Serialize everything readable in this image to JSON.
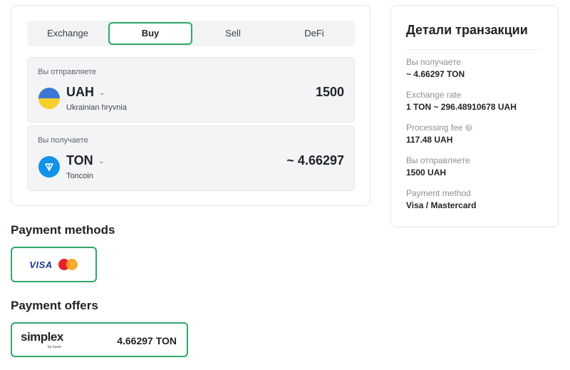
{
  "tabs": [
    {
      "label": "Exchange",
      "active": false
    },
    {
      "label": "Buy",
      "active": true
    },
    {
      "label": "Sell",
      "active": false
    },
    {
      "label": "DeFi",
      "active": false
    }
  ],
  "send": {
    "label": "Вы отправляете",
    "currency_code": "UAH",
    "currency_name": "Ukrainian hryvnia",
    "amount": "1500",
    "icon": "ukraine-flag-icon"
  },
  "receive": {
    "label": "Вы получаете",
    "currency_code": "TON",
    "currency_name": "Toncoin",
    "amount": "~ 4.66297",
    "icon": "toncoin-icon"
  },
  "payment_methods": {
    "title": "Payment methods",
    "selected": {
      "visa_label": "VISA",
      "icon": "mastercard-icon"
    }
  },
  "payment_offers": {
    "title": "Payment offers",
    "offer": {
      "brand": "simplex",
      "brand_sub": "by nuvei",
      "amount": "4.66297 TON"
    }
  },
  "details": {
    "title": "Детали транзакции",
    "rows": [
      {
        "label": "Вы получаете",
        "value": "~ 4.66297 TON"
      },
      {
        "label": "Exchange rate",
        "value": "1 TON ~ 296.48910678 UAH"
      },
      {
        "label": "Processing fee",
        "value": "117.48 UAH",
        "help_icon": "?"
      },
      {
        "label": "Вы отправляете",
        "value": "1500 UAH"
      },
      {
        "label": "Payment method",
        "value": "Visa / Mastercard"
      }
    ]
  },
  "colors": {
    "accent": "#2ea86a",
    "ton_blue": "#1292e6",
    "ua_blue": "#3a78d4",
    "ua_yellow": "#f6cf2b"
  }
}
